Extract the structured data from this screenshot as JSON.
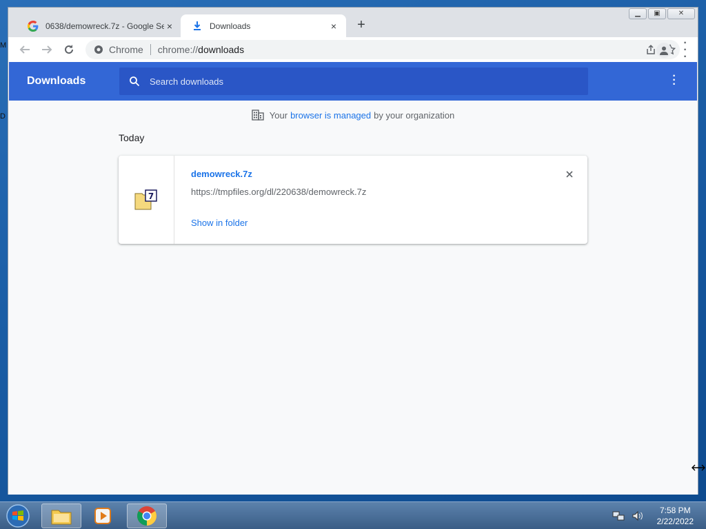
{
  "desktop": {
    "edge_letters": [
      "M",
      "D"
    ]
  },
  "browser": {
    "tabs": [
      {
        "title": "0638/demowreck.7z - Google Se",
        "favicon": "google-icon",
        "close": "×"
      },
      {
        "title": "Downloads",
        "favicon": "download-icon",
        "close": "×"
      }
    ],
    "new_tab": "+",
    "omnibox": {
      "site_label": "Chrome",
      "scheme": "chrome://",
      "host": "downloads"
    }
  },
  "downloads_page": {
    "title": "Downloads",
    "search_placeholder": "Search downloads",
    "managed_notice": {
      "prefix": "Your",
      "link": "browser is managed",
      "suffix": "by your organization"
    },
    "date_header": "Today",
    "items": [
      {
        "filename": "demowreck.7z",
        "url": "https://tmpfiles.org/dl/220638/demowreck.7z",
        "action": "Show in folder",
        "icon": "7z-archive-icon"
      }
    ]
  },
  "taskbar": {
    "clock": {
      "time": "7:58 PM",
      "date": "2/22/2022"
    },
    "apps": [
      "file-explorer-icon",
      "media-player-icon",
      "chrome-icon"
    ]
  },
  "colors": {
    "header_blue": "#3367d6",
    "link_blue": "#1a73e8",
    "search_bg": "#2a56c6"
  }
}
